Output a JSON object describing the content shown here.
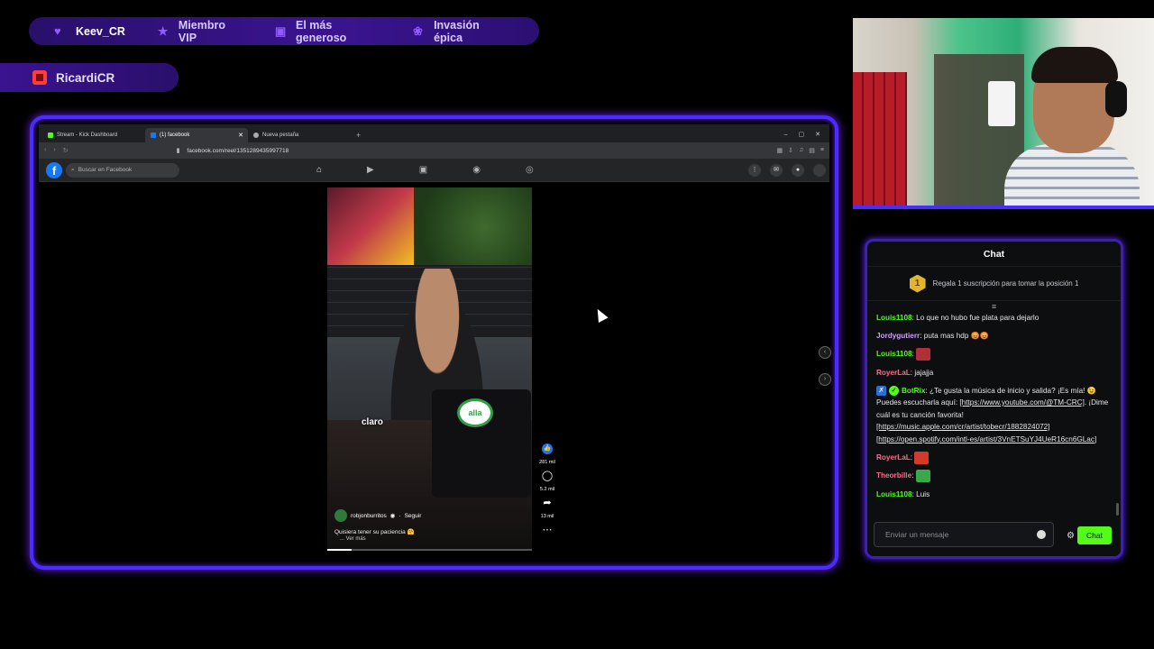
{
  "alerts": [
    {
      "label": "Keev_CR",
      "icon": "heart-icon"
    },
    {
      "label": "Miembro VIP",
      "icon": "star-icon"
    },
    {
      "label": "El más generoso",
      "icon": "gift-icon"
    },
    {
      "label": "Invasión épica",
      "icon": "paw-icon"
    }
  ],
  "host": {
    "name": "RicardiCR",
    "icon": "kick-icon"
  },
  "browser": {
    "tabs": [
      {
        "label": "Stream - Kick Dashboard",
        "color": "#53fc18"
      },
      {
        "label": "(1) facebook",
        "color": "#1877f2"
      },
      {
        "label": "Nueva pestaña",
        "color": "#aaaaaa"
      }
    ],
    "url": "facebook.com/reel/1351289435997718"
  },
  "facebook": {
    "logo": "f",
    "search_placeholder": "Buscar en Facebook",
    "notification_count": "1"
  },
  "reel": {
    "caption": "claro",
    "brand_logo": "alla",
    "author": "robjonburritos",
    "follow": "Seguir",
    "description": "Quisiera tener su paciencia 🤗",
    "see_more": "... Ver más",
    "likes": "281 mil",
    "comments": "5.2 mil",
    "shares": "13 mil",
    "progress": 0.12
  },
  "chat": {
    "title": "Chat",
    "gift_rank": "1",
    "gift_text": "Regala 1 suscripción para tomar la posición 1",
    "input_placeholder": "Enviar un mensaje",
    "send_label": "Chat",
    "messages": [
      {
        "user": "Louis1108",
        "color": "#53fc18",
        "text": "Lo que no hubo fue plata para dejarlo"
      },
      {
        "user": "Jordygutierr",
        "color": "#c9a0ff",
        "text": "puta mas hdp 😡😡"
      },
      {
        "user": "Louis1108",
        "color": "#53fc18",
        "text": "",
        "emote": "#b0303a"
      },
      {
        "user": "RoyerLaL",
        "color": "#ff6b8a",
        "text": "jajajja"
      },
      {
        "user": "BotRix",
        "color": "#53fc18",
        "text": "¿Te gusta la música de inicio y salida? ¡Es mía! 😉 Puedes escucharla aquí: ",
        "link1": "[https://www.youtube.com/@TM-CRC]",
        "text2": ". ¡Dime cuál es tu canción favorita! ",
        "link2": "[https://music.apple.com/cr/artist/tobecr/1882824072]",
        "link3": "[https://open.spotify.com/intl-es/artist/3VnETSuYJ4UeR16cn6GLac]"
      },
      {
        "user": "RoyerLaL",
        "color": "#ff6b8a",
        "text": "",
        "emote": "#d33a2a"
      },
      {
        "user": "Theorbille",
        "color": "#ff6b8a",
        "text": "",
        "emote": "#3aa84a"
      },
      {
        "user": "Louis1108",
        "color": "#53fc18",
        "text": "Luis"
      }
    ]
  }
}
